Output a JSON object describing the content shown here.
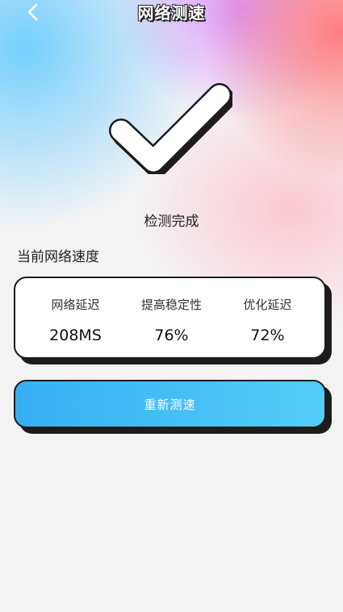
{
  "header": {
    "title": "网络测速",
    "back_icon": "chevron-left-icon"
  },
  "result": {
    "icon": "checkmark-icon",
    "status": "检测完成"
  },
  "speed": {
    "section_title": "当前网络速度",
    "stats": [
      {
        "label": "网络延迟",
        "value": "208MS"
      },
      {
        "label": "提高稳定性",
        "value": "76%"
      },
      {
        "label": "优化延迟",
        "value": "72%"
      }
    ]
  },
  "actions": {
    "retest_label": "重新测速"
  },
  "colors": {
    "button_start": "#36b0f3",
    "button_end": "#54ccf7",
    "outline": "#1c1c1c"
  }
}
